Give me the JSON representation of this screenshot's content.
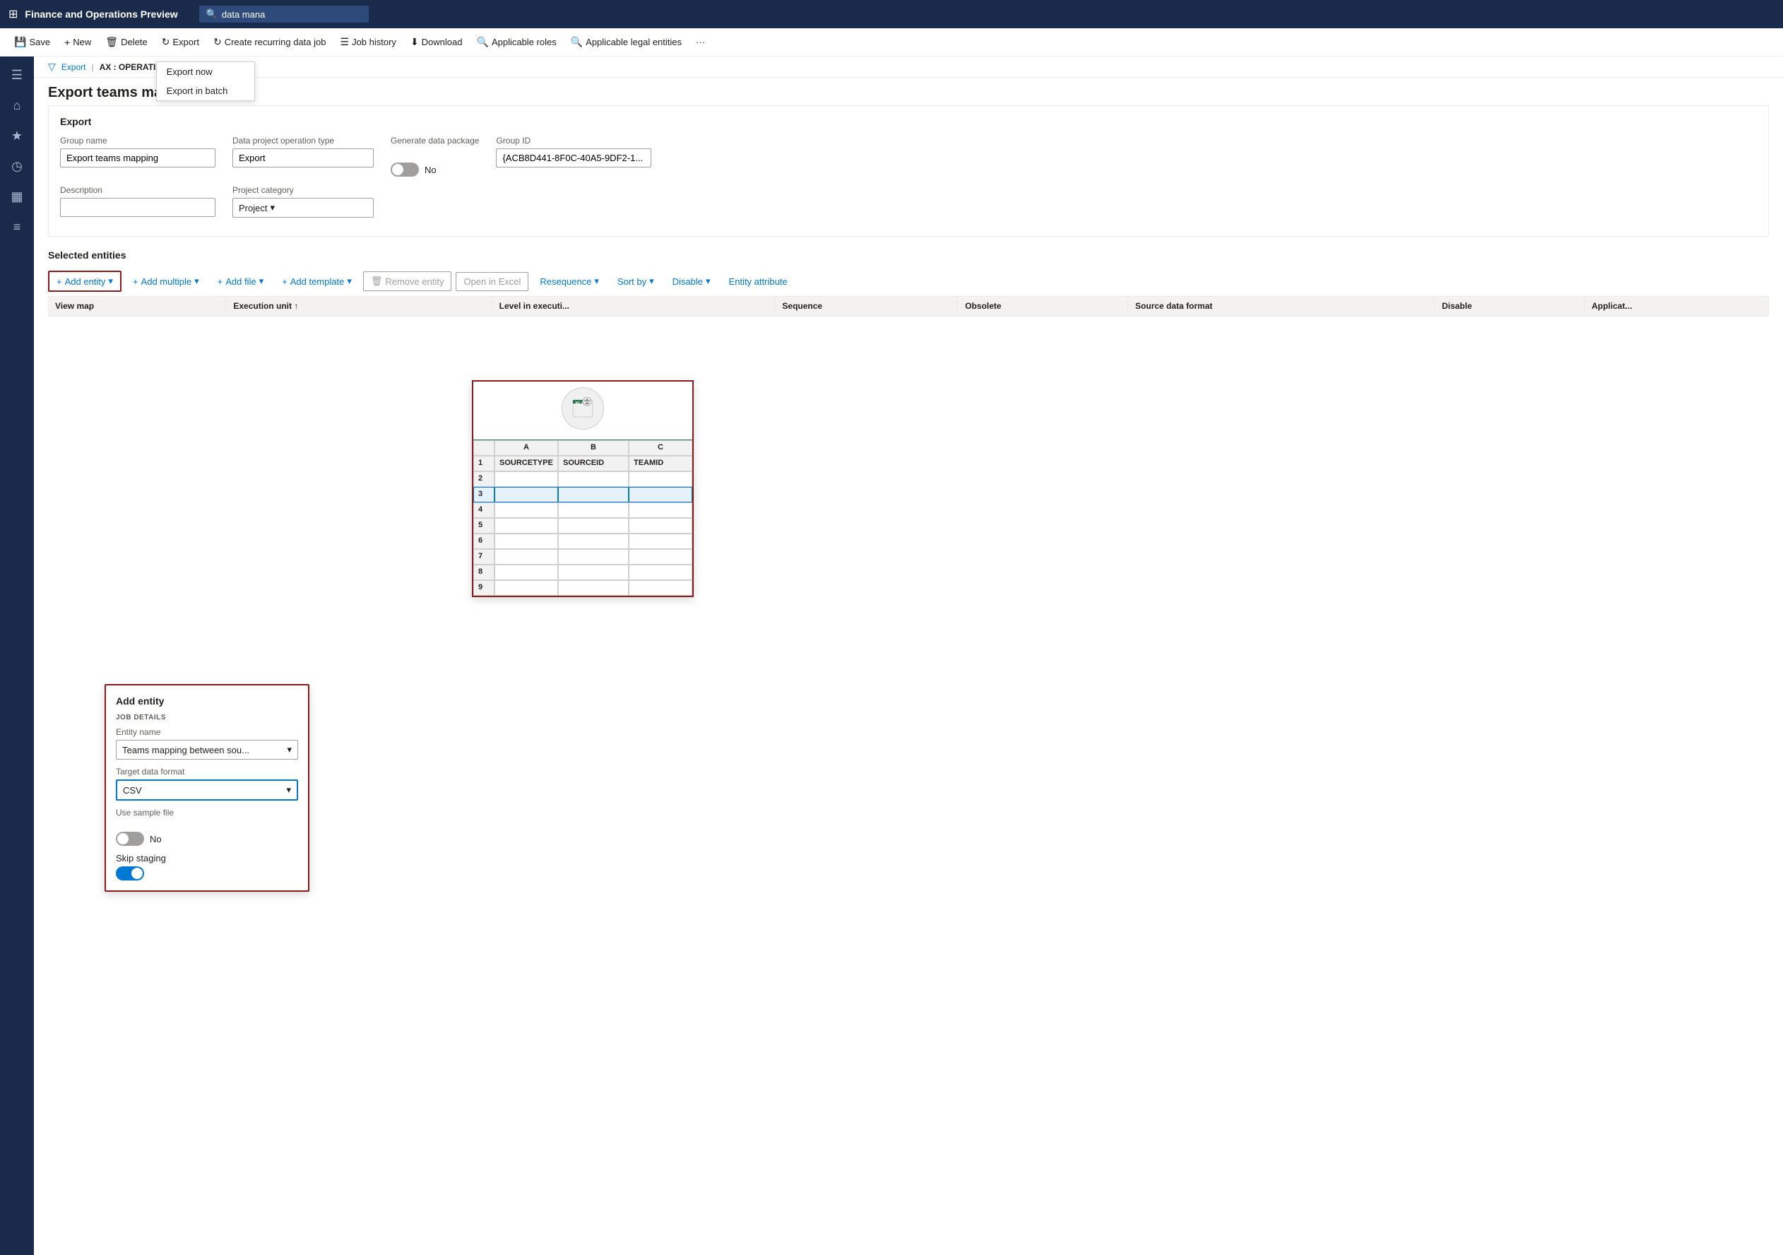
{
  "app": {
    "title": "Finance and Operations Preview",
    "search_value": "data mana"
  },
  "command_bar": {
    "save": "Save",
    "new": "New",
    "delete": "Delete",
    "export": "Export",
    "create_recurring": "Create recurring data job",
    "job_history": "Job history",
    "download": "Download",
    "applicable_roles": "Applicable roles",
    "applicable_legal": "Applicable legal entities"
  },
  "export_menu": {
    "export_now": "Export now",
    "export_in_batch": "Export in batch"
  },
  "sidebar": {
    "icons": [
      "⊞",
      "⌂",
      "★",
      "◷",
      "▦",
      "≡"
    ]
  },
  "breadcrumb": {
    "export": "Export",
    "separator": "|",
    "company": "AX : OPERATIONS"
  },
  "page": {
    "title": "Export teams mapping"
  },
  "form": {
    "section_title": "Export",
    "group_name_label": "Group name",
    "group_name_value": "Export teams mapping",
    "data_project_label": "Data project operation type",
    "data_project_value": "Export",
    "generate_package_label": "Generate data package",
    "generate_package_value": "No",
    "group_id_label": "Group ID",
    "group_id_value": "{ACB8D441-8F0C-40A5-9DF2-1...",
    "description_label": "Description",
    "description_value": "",
    "project_category_label": "Project category",
    "project_category_value": "Project"
  },
  "selected_entities": {
    "title": "Selected entities",
    "toolbar": {
      "add_entity": "Add entity",
      "add_multiple": "Add multiple",
      "add_file": "Add file",
      "add_template": "Add template",
      "remove_entity": "Remove entity",
      "open_in_excel": "Open in Excel",
      "resequence": "Resequence",
      "sort_by": "Sort by",
      "disable": "Disable",
      "entity_attribute": "Entity attribute"
    },
    "table_headers": [
      "View map",
      "Execution unit ↑",
      "Level in executi...",
      "Sequence",
      "Obsolete",
      "Source data format",
      "Disable",
      "Applicat..."
    ]
  },
  "add_entity_panel": {
    "title": "Add entity",
    "job_details_label": "JOB DETAILS",
    "entity_name_label": "Entity name",
    "entity_name_value": "Teams mapping between sou...",
    "target_format_label": "Target data format",
    "target_format_value": "CSV",
    "use_sample_label": "Use sample file",
    "use_sample_value": "No",
    "skip_staging_label": "Skip staging"
  },
  "excel_preview": {
    "columns": [
      "",
      "A",
      "B",
      "C"
    ],
    "header_row": [
      "",
      "SOURCETYPE",
      "SOURCEID",
      "TEAMID"
    ],
    "rows": [
      "2",
      "3",
      "4",
      "5",
      "6",
      "7",
      "8",
      "9"
    ]
  }
}
